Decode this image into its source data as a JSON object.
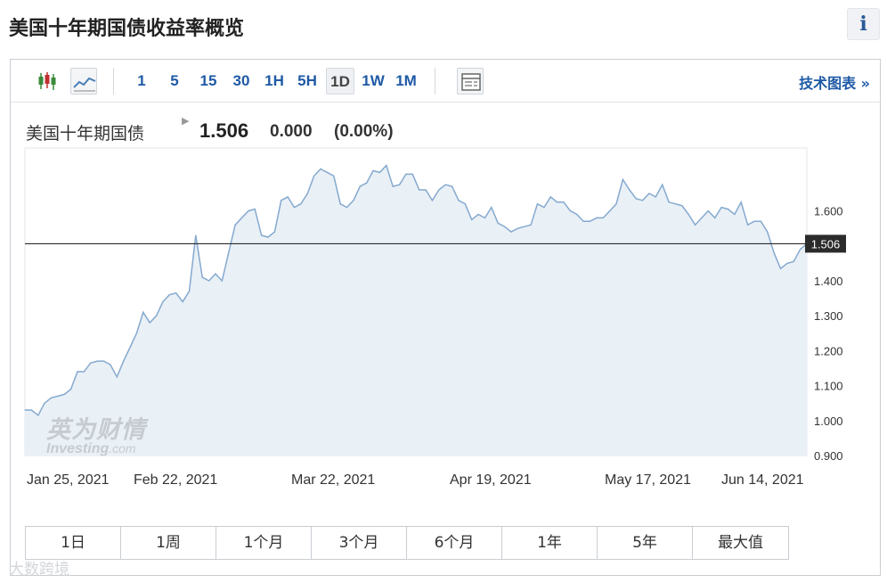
{
  "header": {
    "title": "美国十年期国债收益率概览",
    "info_icon": "i"
  },
  "toolbar": {
    "icons": [
      "candlestick-icon",
      "line-chart-icon",
      "table-view-icon"
    ],
    "intervals": [
      "1",
      "5",
      "15",
      "30",
      "1H",
      "5H",
      "1D",
      "1W",
      "1M"
    ],
    "active_interval": "1D",
    "tech_chart_link": "技术图表 »"
  },
  "quote": {
    "name": "美国十年期国债",
    "last": "1.506",
    "change": "0.000",
    "change_pct": "(0.00%)"
  },
  "current_value_label": "1.506",
  "watermark": {
    "cn": "英为财情",
    "en": "Investing",
    "en_suffix": ".com"
  },
  "periods": [
    "1日",
    "1周",
    "1个月",
    "3个月",
    "6个月",
    "1年",
    "5年",
    "最大值"
  ],
  "corner_mark": "大数跨境",
  "colors": {
    "line": "#85a9cf",
    "fill": "#e9f0f6",
    "accent": "#1f5aa5",
    "badge": "#2b2b2b"
  },
  "chart_data": {
    "type": "area",
    "title": "",
    "xlabel": "",
    "ylabel": "",
    "ylim": [
      0.9,
      1.78
    ],
    "y_ticks": [
      "0.900",
      "1.000",
      "1.100",
      "1.200",
      "1.300",
      "1.400",
      "1.600"
    ],
    "x_ticks": [
      "Jan 25, 2021",
      "Feb 22, 2021",
      "Mar 22, 2021",
      "Apr 19, 2021",
      "May 17, 2021",
      "Jun 14, 2021"
    ],
    "reference_line": 1.506,
    "grid": false,
    "values": [
      1.03,
      1.03,
      1.015,
      1.05,
      1.065,
      1.07,
      1.075,
      1.09,
      1.14,
      1.14,
      1.165,
      1.17,
      1.17,
      1.16,
      1.125,
      1.17,
      1.21,
      1.25,
      1.31,
      1.28,
      1.3,
      1.34,
      1.36,
      1.365,
      1.34,
      1.37,
      1.53,
      1.41,
      1.4,
      1.42,
      1.4,
      1.48,
      1.56,
      1.58,
      1.6,
      1.605,
      1.53,
      1.525,
      1.54,
      1.63,
      1.64,
      1.61,
      1.62,
      1.65,
      1.7,
      1.72,
      1.71,
      1.7,
      1.62,
      1.61,
      1.63,
      1.67,
      1.68,
      1.715,
      1.71,
      1.73,
      1.67,
      1.675,
      1.705,
      1.705,
      1.66,
      1.66,
      1.63,
      1.66,
      1.675,
      1.67,
      1.63,
      1.62,
      1.575,
      1.59,
      1.58,
      1.61,
      1.565,
      1.555,
      1.54,
      1.55,
      1.555,
      1.56,
      1.62,
      1.61,
      1.64,
      1.625,
      1.625,
      1.6,
      1.59,
      1.57,
      1.57,
      1.58,
      1.58,
      1.6,
      1.62,
      1.69,
      1.66,
      1.635,
      1.63,
      1.65,
      1.64,
      1.675,
      1.625,
      1.62,
      1.615,
      1.59,
      1.56,
      1.58,
      1.6,
      1.58,
      1.61,
      1.605,
      1.59,
      1.625,
      1.56,
      1.57,
      1.57,
      1.54,
      1.48,
      1.435,
      1.45,
      1.455,
      1.49,
      1.506
    ]
  }
}
